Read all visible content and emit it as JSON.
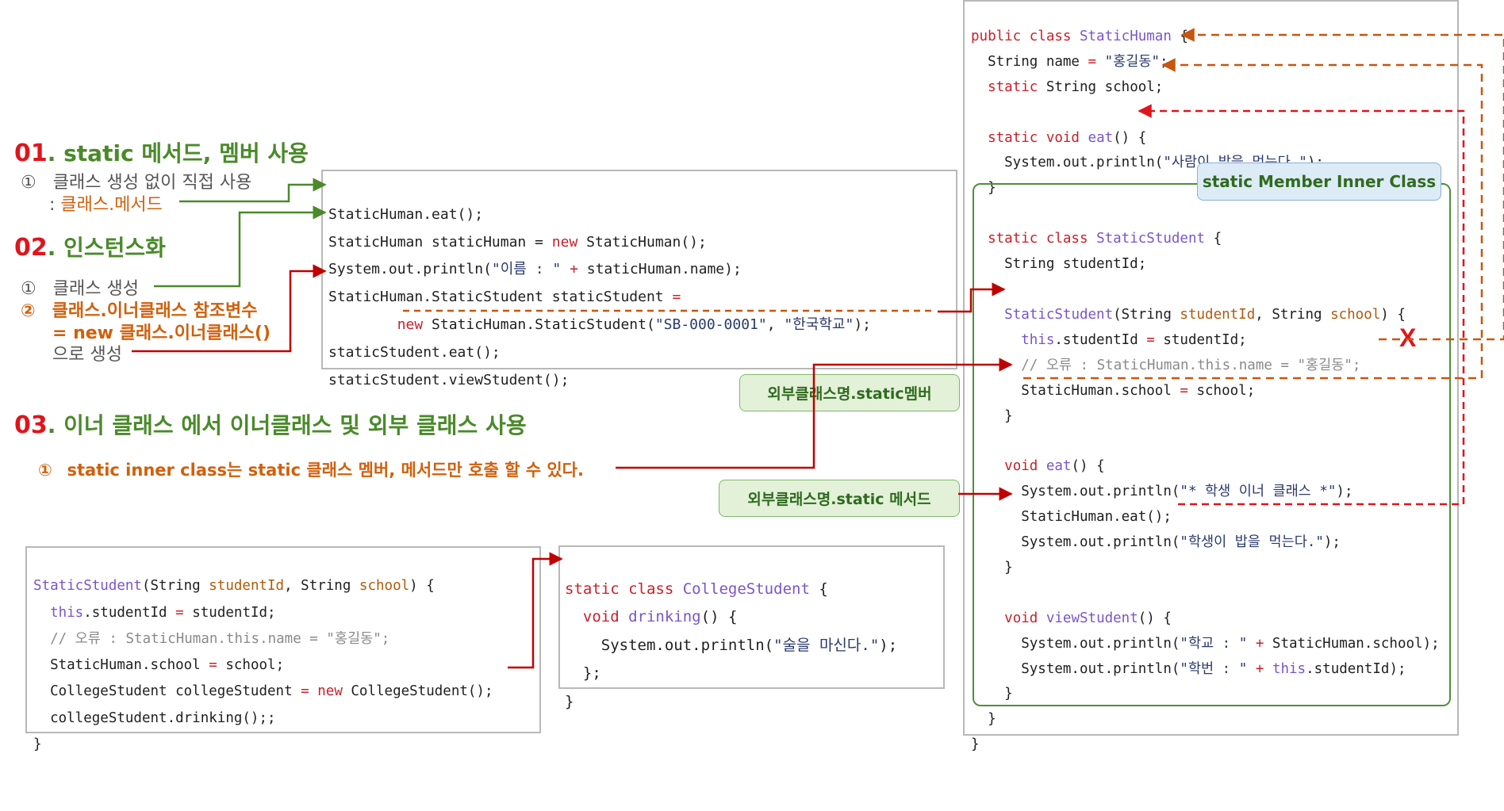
{
  "sections": {
    "s01_num": "01",
    "s01_title": ". static 메서드, 멤버 사용",
    "s01_item_marker": "①",
    "s01_item": "클래스 생성 없이 직접 사용",
    "s01_item_sub_prefix": ": ",
    "s01_item_sub": "클래스.메서드",
    "s02_num": "02",
    "s02_title": ". 인스턴스화",
    "s02_item1_marker": "①",
    "s02_item1": "클래스 생성",
    "s02_item2_marker": "②",
    "s02_item2_line1": "클래스.이너클래스 참조변수",
    "s02_item2_line2": "= new 클래스.이너클래스()",
    "s02_item2_line3": "으로 생성",
    "s03_num": "03",
    "s03_title": ". 이너 클래스 에서 이너클래스 및 외부 클래스 사용",
    "s03_item_marker": "①",
    "s03_item": "static inner class는 static 클래스 멤버, 메서드만 호출 할 수 있다."
  },
  "labels": {
    "member_inner_class": "static Member Inner Class",
    "outer_static_member": "외부클래스명.static멤버",
    "outer_static_method": "외부클래스명.static 메서드",
    "error_mark": "X"
  },
  "code_main": [
    "StaticHuman.eat();",
    "StaticHuman staticHuman = new StaticHuman();",
    "System.out.println(\"이름 : \" + staticHuman.name);",
    "StaticHuman.StaticStudent staticStudent =",
    "        new StaticHuman.StaticStudent(\"SB-000-0001\", \"한국학교\");",
    "staticStudent.eat();",
    "staticStudent.viewStudent();"
  ],
  "code_right": [
    "public class StaticHuman {",
    "  String name = \"홍길동\";",
    "  static String school;",
    "",
    "  static void eat() {",
    "    System.out.println(\"사람이 밥을 먹는다.\");",
    "  }",
    "",
    "  static class StaticStudent {",
    "    String studentId;",
    "",
    "    StaticStudent(String studentId, String school) {",
    "      this.studentId = studentId;",
    "      // 오류 : StaticHuman.this.name = \"홍길동\";",
    "      StaticHuman.school = school;",
    "    }",
    "",
    "    void eat() {",
    "      System.out.println(\"* 학생 이너 클래스 *\");",
    "      StaticHuman.eat();",
    "      System.out.println(\"학생이 밥을 먹는다.\");",
    "    }",
    "",
    "    void viewStudent() {",
    "      System.out.println(\"학교 : \" + StaticHuman.school);",
    "      System.out.println(\"학번 : \" + this.studentId);",
    "    }",
    "  }",
    "}"
  ],
  "code_bottom_left": [
    "StaticStudent(String studentId, String school) {",
    "  this.studentId = studentId;",
    "  // 오류 : StaticHuman.this.name = \"홍길동\";",
    "  StaticHuman.school = school;",
    "  CollegeStudent collegeStudent = new CollegeStudent();",
    "  collegeStudent.drinking();;",
    "}"
  ],
  "code_bottom_mid": [
    "static class CollegeStudent {",
    "  void drinking() {",
    "    System.out.println(\"술을 마신다.\");",
    "  };",
    "}"
  ],
  "colors": {
    "accent_green": "#4a8a2a",
    "number_red": "#e0141c",
    "orange": "#d0600c",
    "arrow_red": "#c00000",
    "dash_orange": "#c8560e"
  }
}
